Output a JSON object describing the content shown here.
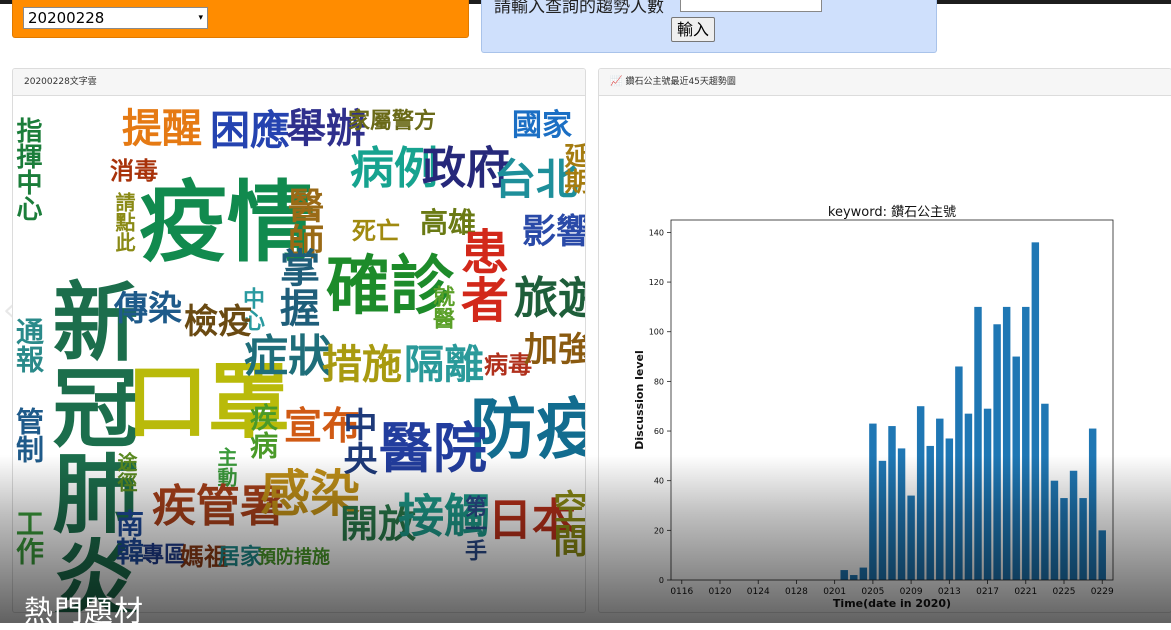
{
  "date_selector": {
    "value": "20200228",
    "arrow": "▾"
  },
  "keyword_form": {
    "label": "請輸入查詢的趨勢人數",
    "submit_label": "輸入"
  },
  "wordcloud_card": {
    "title": "20200228文字雲",
    "words": [
      {
        "text": "新冠肺炎",
        "color": "#1c6e4c"
      },
      {
        "text": "疫情",
        "color": "#118a4e"
      },
      {
        "text": "口罩",
        "color": "#b9ba0a"
      },
      {
        "text": "確診",
        "color": "#1d8b2a"
      },
      {
        "text": "防疫",
        "color": "#126c8f"
      },
      {
        "text": "醫院",
        "color": "#223d9e"
      },
      {
        "text": "病例",
        "color": "#16a38f"
      },
      {
        "text": "政府",
        "color": "#26287a"
      },
      {
        "text": "台北",
        "color": "#1e8f9a"
      },
      {
        "text": "提醒",
        "color": "#e57a14"
      },
      {
        "text": "困應",
        "color": "#2543b0"
      },
      {
        "text": "舉辦",
        "color": "#2f2f8c"
      },
      {
        "text": "家屬警方",
        "color": "#6a6a18"
      },
      {
        "text": "國家",
        "color": "#1b6fc4"
      },
      {
        "text": "延期",
        "color": "#a57c10"
      },
      {
        "text": "指揮中心",
        "color": "#1b7d3a"
      },
      {
        "text": "消毒",
        "color": "#a8320a"
      },
      {
        "text": "請點此",
        "color": "#8a8a15"
      },
      {
        "text": "醫師",
        "color": "#9a6a16"
      },
      {
        "text": "死亡",
        "color": "#a08a10"
      },
      {
        "text": "高雄",
        "color": "#6a7a14"
      },
      {
        "text": "患者",
        "color": "#d2281a"
      },
      {
        "text": "影響",
        "color": "#2a4aa8"
      },
      {
        "text": "掌握",
        "color": "#1f5e7a"
      },
      {
        "text": "中心",
        "color": "#2a9aa0"
      },
      {
        "text": "傳染",
        "color": "#1e5a8a"
      },
      {
        "text": "檢疫",
        "color": "#6a4a12"
      },
      {
        "text": "就醫",
        "color": "#5aa028"
      },
      {
        "text": "旅遊",
        "color": "#1e5e3a"
      },
      {
        "text": "通報",
        "color": "#2a8a8a"
      },
      {
        "text": "症狀",
        "color": "#1f6e7a"
      },
      {
        "text": "措施",
        "color": "#a89a10"
      },
      {
        "text": "隔離",
        "color": "#2a9a9a"
      },
      {
        "text": "病毒",
        "color": "#b0301c"
      },
      {
        "text": "加強",
        "color": "#8a5a10"
      },
      {
        "text": "管制",
        "color": "#1e5a8a"
      },
      {
        "text": "疾病",
        "color": "#4a9a28"
      },
      {
        "text": "宣布",
        "color": "#d05a14"
      },
      {
        "text": "中央",
        "color": "#1e3a7a"
      },
      {
        "text": "主動",
        "color": "#3a9a3a"
      },
      {
        "text": "途徑",
        "color": "#5a8a20"
      },
      {
        "text": "疾管署",
        "color": "#a8401a"
      },
      {
        "text": "感染",
        "color": "#c09018"
      },
      {
        "text": "開放",
        "color": "#2a7a4a"
      },
      {
        "text": "接觸",
        "color": "#1e9a8a"
      },
      {
        "text": "第一手",
        "color": "#2a4a8a"
      },
      {
        "text": "日本",
        "color": "#b8301a"
      },
      {
        "text": "空間",
        "color": "#8a8a14"
      },
      {
        "text": "工作",
        "color": "#3a9a3a"
      },
      {
        "text": "南韓",
        "color": "#1e4a9a"
      },
      {
        "text": "專區",
        "color": "#1e3a8a"
      },
      {
        "text": "媽祖",
        "color": "#8a3a14"
      },
      {
        "text": "居家",
        "color": "#1e8a8a"
      },
      {
        "text": "預防措施",
        "color": "#4a9a2a"
      }
    ]
  },
  "trend_card": {
    "title": "鑽石公主號最近45天趨勢圖",
    "icon": "chart-icon"
  },
  "chart_data": {
    "type": "bar",
    "title": "keyword: 鑽石公主號",
    "xlabel": "Time(date in 2020)",
    "ylabel": "Discussion level",
    "ylim": [
      0,
      145
    ],
    "yticks": [
      0,
      20,
      40,
      60,
      80,
      100,
      120,
      140
    ],
    "xtick_labels": [
      "0116",
      "0120",
      "0124",
      "0128",
      "0201",
      "0205",
      "0209",
      "0213",
      "0217",
      "0221",
      "0225",
      "0229"
    ],
    "dates": [
      "0116",
      "0117",
      "0118",
      "0119",
      "0120",
      "0121",
      "0122",
      "0123",
      "0124",
      "0125",
      "0126",
      "0127",
      "0128",
      "0129",
      "0130",
      "0131",
      "0201",
      "0202",
      "0203",
      "0204",
      "0205",
      "0206",
      "0207",
      "0208",
      "0209",
      "0210",
      "0211",
      "0212",
      "0213",
      "0214",
      "0215",
      "0216",
      "0217",
      "0218",
      "0219",
      "0220",
      "0221",
      "0222",
      "0223",
      "0224",
      "0225",
      "0226",
      "0227",
      "0228",
      "0229"
    ],
    "values": [
      0,
      0,
      0,
      0,
      0,
      0,
      0,
      0,
      0,
      0,
      0,
      0,
      0,
      0,
      0,
      0,
      0,
      4,
      2,
      5,
      63,
      48,
      62,
      53,
      34,
      70,
      54,
      65,
      57,
      86,
      67,
      110,
      69,
      103,
      110,
      90,
      110,
      136,
      71,
      40,
      33,
      44,
      33,
      61,
      20
    ],
    "bar_color": "#1f77b4",
    "grid": false
  },
  "overlay": {
    "title": "熱門題材",
    "prev_arrow": "‹"
  }
}
